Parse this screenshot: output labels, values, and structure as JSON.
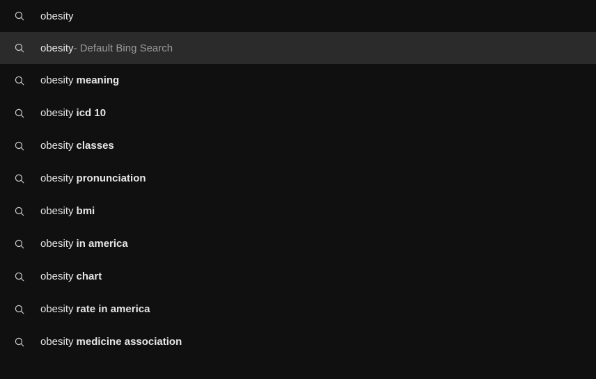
{
  "search": {
    "query": "obesity"
  },
  "default_suggestion": {
    "text": "obesity",
    "description": " - Default Bing Search"
  },
  "suggestions": [
    {
      "prefix": "obesity",
      "completion": "meaning"
    },
    {
      "prefix": "obesity",
      "completion": "icd 10"
    },
    {
      "prefix": "obesity",
      "completion": "classes"
    },
    {
      "prefix": "obesity",
      "completion": "pronunciation"
    },
    {
      "prefix": "obesity",
      "completion": "bmi"
    },
    {
      "prefix": "obesity",
      "completion": "in america"
    },
    {
      "prefix": "obesity",
      "completion": "chart"
    },
    {
      "prefix": "obesity",
      "completion": "rate in america"
    },
    {
      "prefix": "obesity",
      "completion": "medicine association"
    }
  ]
}
